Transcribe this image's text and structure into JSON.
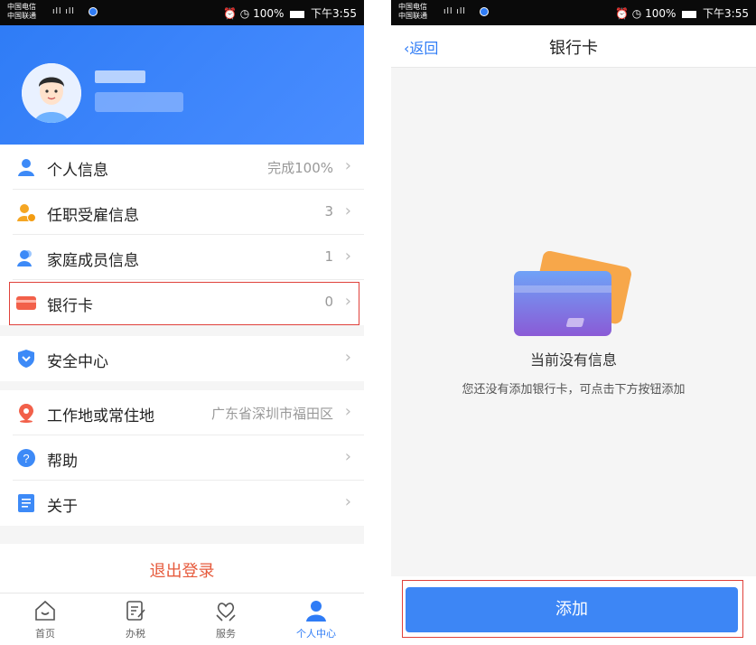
{
  "status_bar": {
    "carrier_top": "中国电信",
    "carrier_bottom": "中国联通",
    "time_battery": "100%",
    "time": "下午3:55"
  },
  "left_screen": {
    "menu": [
      {
        "label": "个人信息",
        "value": "完成100%",
        "icon": "person-icon"
      },
      {
        "label": "任职受雇信息",
        "value": "3",
        "icon": "employment-icon"
      },
      {
        "label": "家庭成员信息",
        "value": "1",
        "icon": "family-icon"
      },
      {
        "label": "银行卡",
        "value": "0",
        "icon": "bank-card-icon"
      },
      {
        "label": "安全中心",
        "value": "",
        "icon": "shield-icon"
      },
      {
        "label": "工作地或常住地",
        "value": "广东省深圳市福田区",
        "icon": "location-icon"
      },
      {
        "label": "帮助",
        "value": "",
        "icon": "help-icon"
      },
      {
        "label": "关于",
        "value": "",
        "icon": "about-icon"
      }
    ],
    "logout": "退出登录",
    "tabs": [
      {
        "label": "首页",
        "icon": "home-icon"
      },
      {
        "label": "办税",
        "icon": "tax-icon"
      },
      {
        "label": "服务",
        "icon": "service-icon"
      },
      {
        "label": "个人中心",
        "icon": "profile-icon"
      }
    ],
    "active_tab": "个人中心"
  },
  "right_screen": {
    "back": "返回",
    "title": "银行卡",
    "empty_title": "当前没有信息",
    "empty_desc": "您还没有添加银行卡，可点击下方按钮添加",
    "add_button": "添加"
  },
  "colors": {
    "accent": "#2f7cf6",
    "highlight": "#e0413b",
    "logout": "#e65a3c"
  }
}
